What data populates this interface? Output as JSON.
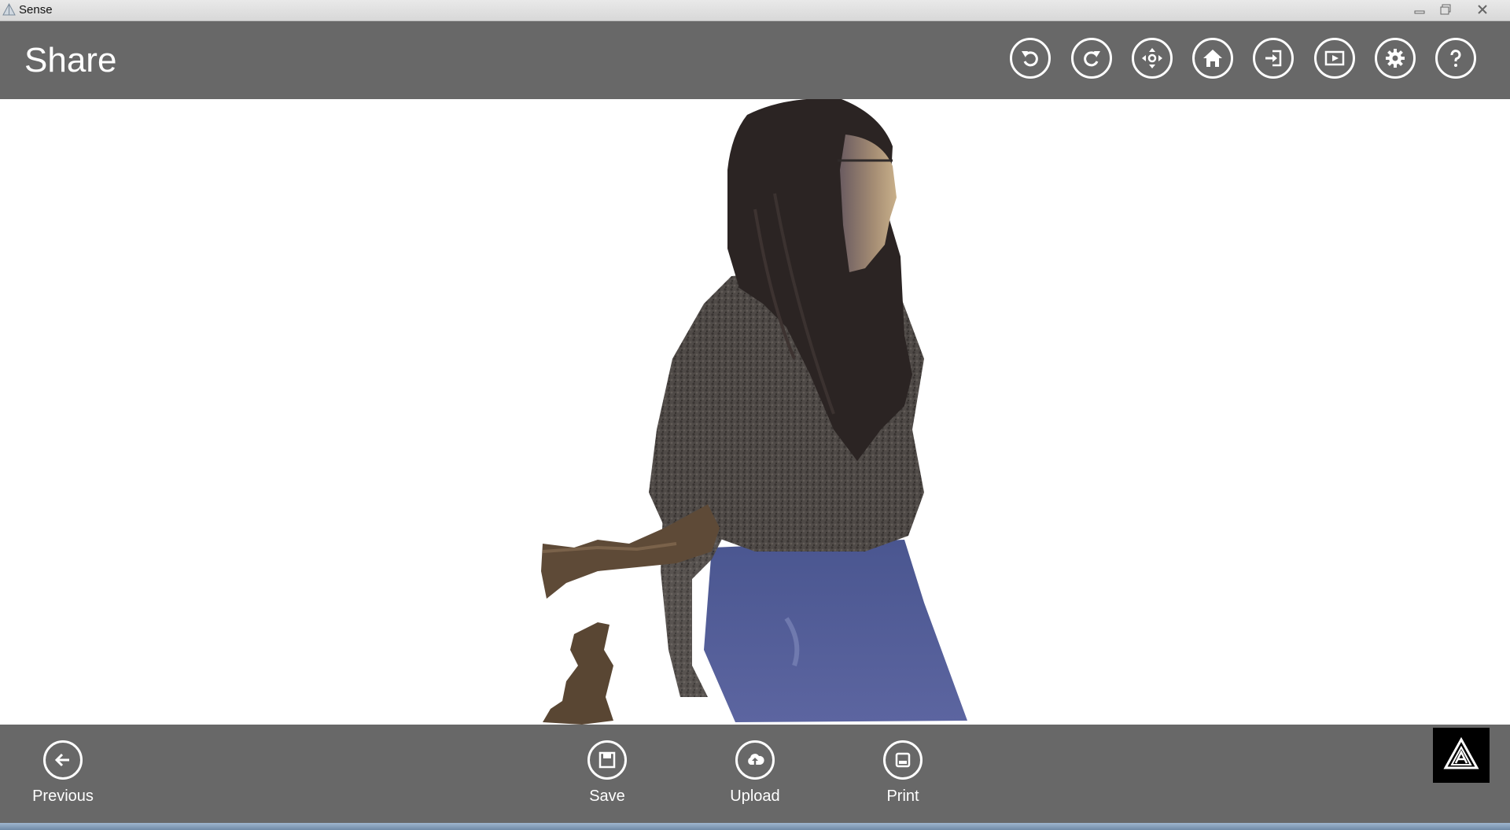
{
  "window": {
    "title": "Sense"
  },
  "header": {
    "title": "Share",
    "tools": [
      {
        "name": "undo-icon"
      },
      {
        "name": "redo-icon"
      },
      {
        "name": "move-icon"
      },
      {
        "name": "home-icon"
      },
      {
        "name": "sign-in-icon"
      },
      {
        "name": "play-icon"
      },
      {
        "name": "gear-icon"
      },
      {
        "name": "help-icon"
      }
    ]
  },
  "bottombar": {
    "previous_label": "Previous",
    "save_label": "Save",
    "upload_label": "Upload",
    "print_label": "Print"
  },
  "colors": {
    "bar": "#686868",
    "canvas": "#ffffff",
    "accent": "#ffffff"
  }
}
